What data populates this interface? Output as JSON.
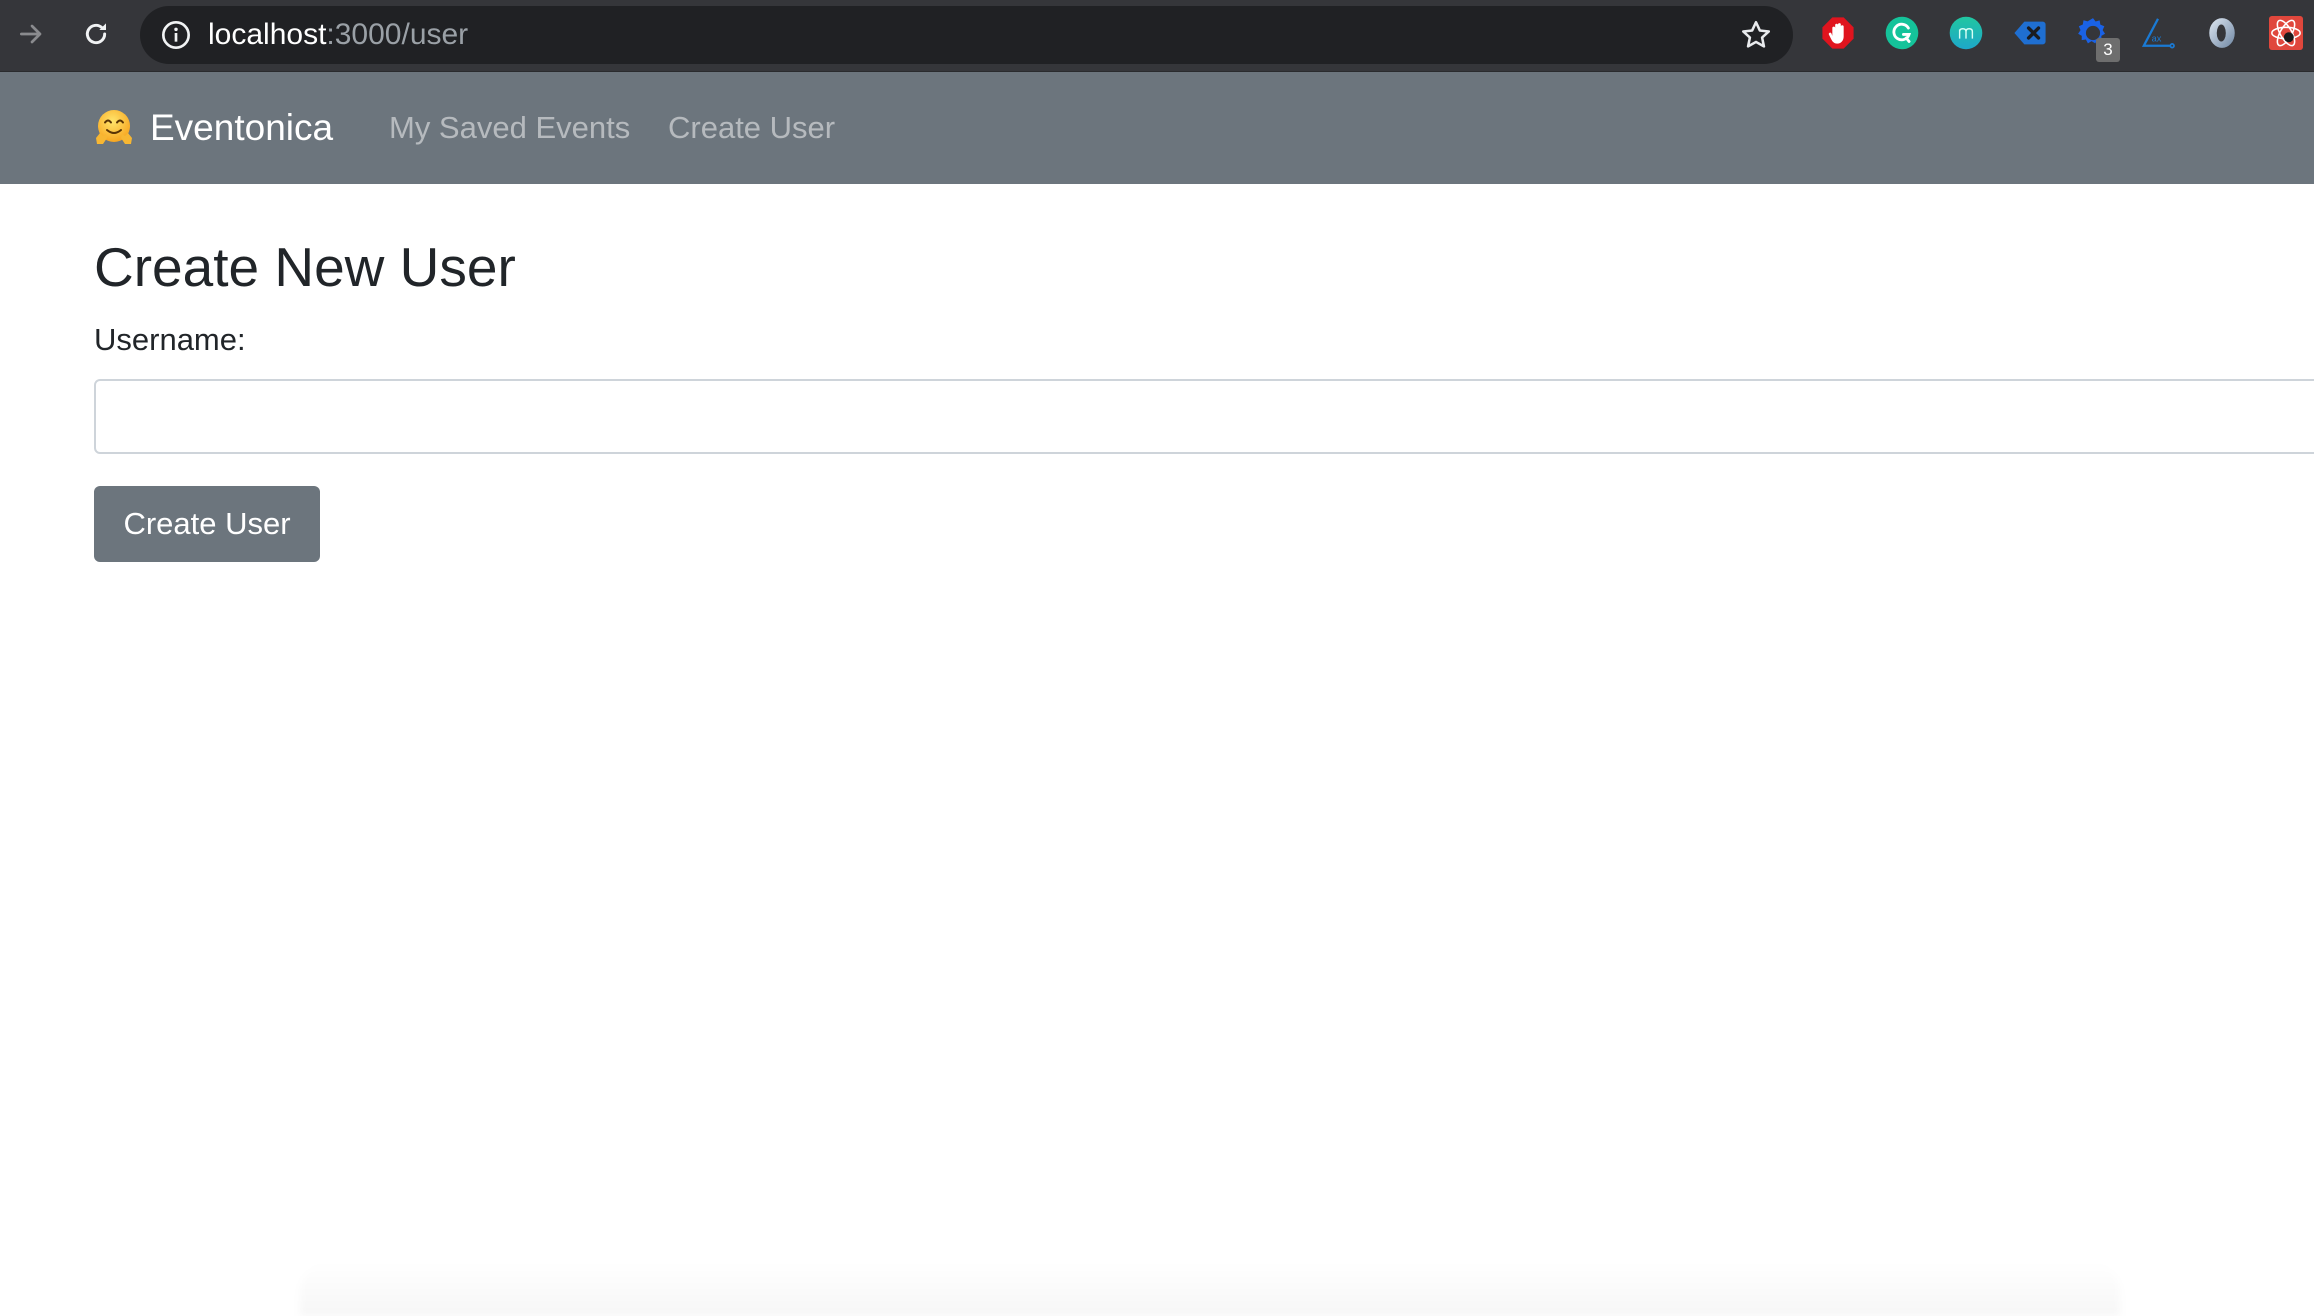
{
  "browser": {
    "url_host": "localhost",
    "url_rest": ":3000/user",
    "extensions": [
      {
        "name": "adblock",
        "icon": "stop-hand-icon",
        "color": "#e0141e"
      },
      {
        "name": "grammarly",
        "icon": "grammarly-icon",
        "color": "#15c39a"
      },
      {
        "name": "mercury",
        "icon": "m-circle-icon",
        "color": "#1fb5b0"
      },
      {
        "name": "clear",
        "icon": "backspace-icon",
        "color": "#1f6fd1"
      },
      {
        "name": "gear-extension",
        "icon": "gear-icon",
        "color": "#1a62e6",
        "badge": "3"
      },
      {
        "name": "axe",
        "icon": "axe-icon",
        "color": "#1a7ad4"
      },
      {
        "name": "json-viewer",
        "icon": "ring-icon",
        "color": "#9fb0c4"
      },
      {
        "name": "react-devtools",
        "icon": "react-bug-icon",
        "color": "#e0473c"
      }
    ]
  },
  "navbar": {
    "brand_emoji": "🤗",
    "brand": "Eventonica",
    "links": [
      {
        "label": "My Saved Events"
      },
      {
        "label": "Create User"
      }
    ],
    "bg_color": "#6c757d"
  },
  "page": {
    "title": "Create New User",
    "username_label": "Username:",
    "username_value": "",
    "submit_label": "Create User"
  }
}
